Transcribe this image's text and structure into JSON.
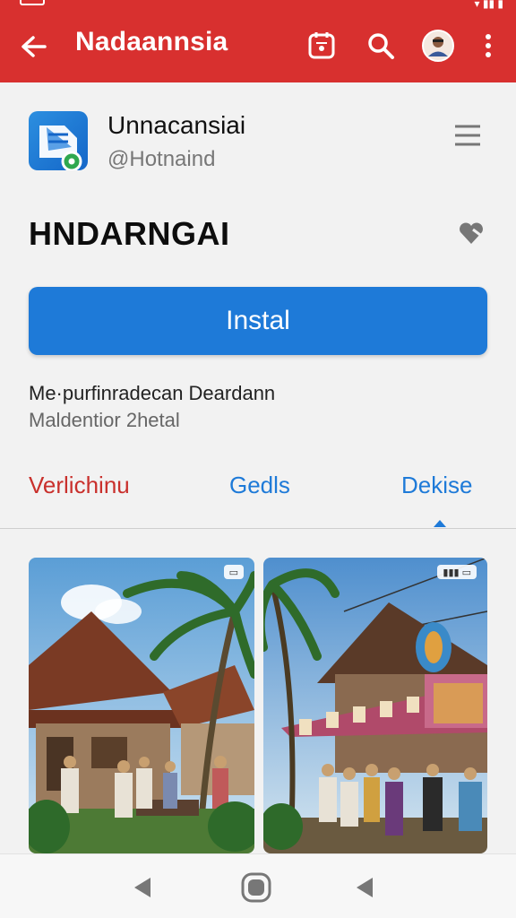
{
  "appbar": {
    "title": "Nadaannsia"
  },
  "app": {
    "name": "Unnacansiai",
    "handle": "@Hotnaind"
  },
  "headline": "HNDARNGAI",
  "install_label": "Instal",
  "description": {
    "line1": "Me·purfinradecan Deardann",
    "line2": "Maldentior 2hetal"
  },
  "tabs": [
    {
      "label": "Verlichinu",
      "color": "#c9302c"
    },
    {
      "label": "Gedls",
      "color": "#1e7ad8"
    },
    {
      "label": "Dekise",
      "color": "#1e7ad8"
    }
  ],
  "colors": {
    "appbar": "#d8302f",
    "accent": "#1e7ad8"
  },
  "icons": {
    "back": "arrow-left-icon",
    "calendar": "calendar-icon",
    "search": "search-icon",
    "avatar": "avatar",
    "overflow": "more-vert-icon"
  }
}
